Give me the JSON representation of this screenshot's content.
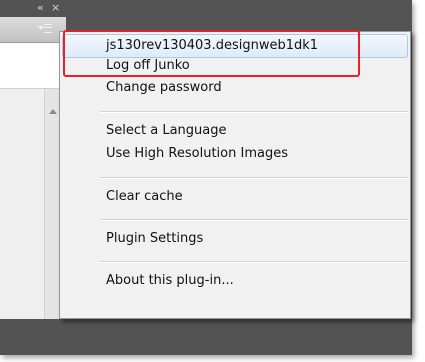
{
  "panel": {
    "collapse_icon": "«",
    "close_icon": "×",
    "flyout_menu_icon": "panel-menu-icon",
    "scroll_up_icon": "scroll-up-arrow-icon"
  },
  "menu": {
    "items": [
      {
        "label": "js130rev130403.designweb1dk1"
      },
      {
        "label": "Log off Junko"
      },
      {
        "label": "Change password"
      },
      {
        "label": "Select a Language"
      },
      {
        "label": "Use High Resolution Images"
      },
      {
        "label": "Clear cache"
      },
      {
        "label": "Plugin Settings"
      },
      {
        "label": "About this plug-in..."
      }
    ]
  },
  "colors": {
    "highlight_border": "#e8202a",
    "panel_dark": "#545454",
    "menu_bg": "#f1f1f1",
    "hover_border": "#aac8ee"
  }
}
